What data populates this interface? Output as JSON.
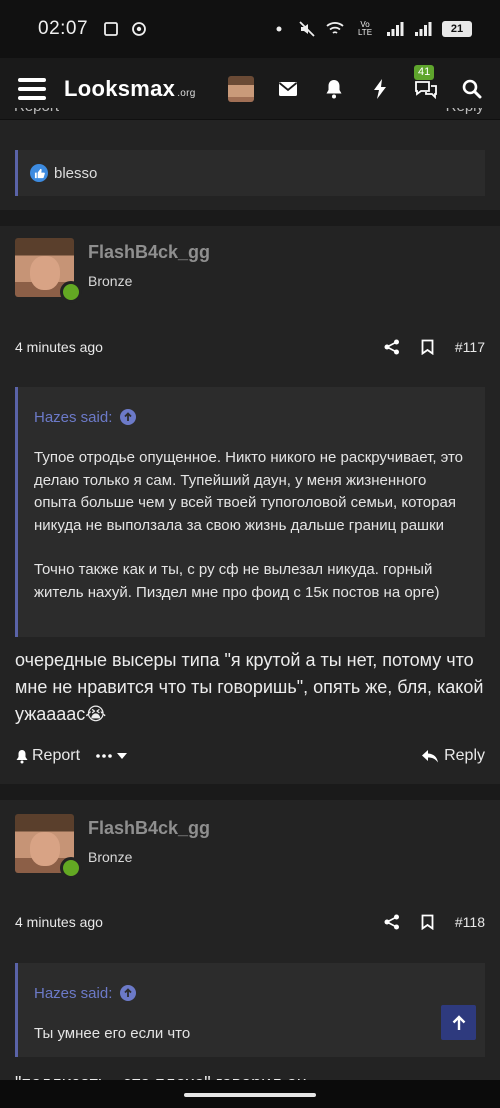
{
  "status": {
    "time": "02:07",
    "network": "Vo LTE",
    "battery": "21"
  },
  "header": {
    "logo": "Looksmax",
    "logo_suffix": ".org",
    "conversations_badge": "41"
  },
  "top_partial": {
    "report_label": "Report",
    "reply_label": "Reply"
  },
  "reactions": {
    "users": "blesso"
  },
  "posts": [
    {
      "username": "FlashB4ck_gg",
      "rank": "Bronze",
      "time": "4 minutes ago",
      "number": "#117",
      "quote": {
        "author": "Hazes said:",
        "paragraphs": [
          "Тупое отродье опущенное. Никто никого не раскручивает, это делаю только я сам. Тупейший даун, у меня жизненного опыта больше чем у всей твоей тупоголовой семьи, которая никуда не выползала за свою жизнь дальше границ рашки",
          "Точно также как и ты, с ру сф не вылезал никуда. горный житель нахуй. Пиздел мне про фоид с 15к постов на орге)"
        ]
      },
      "text": "очередные высеры типа \"я крутой а ты нет, потому что мне не нравится что ты говоришь\", опять же, бля, какой ужаааас😭",
      "report_label": "Report",
      "reply_label": "Reply"
    },
    {
      "username": "FlashB4ck_gg",
      "rank": "Bronze",
      "time": "4 minutes ago",
      "number": "#118",
      "quote": {
        "author": "Hazes said:",
        "paragraphs": [
          "Ты умнее его если что"
        ]
      },
      "text": "\"подлизать - это плохо\" говорил он"
    }
  ],
  "colors": {
    "background": "#1d1d1d",
    "post_bg": "#232323",
    "quote_accent": "#5a63a8",
    "quote_author": "#6c7ac8",
    "online": "#63a823",
    "badge": "#5fa52d",
    "scroll_button": "#2e3a7e"
  }
}
